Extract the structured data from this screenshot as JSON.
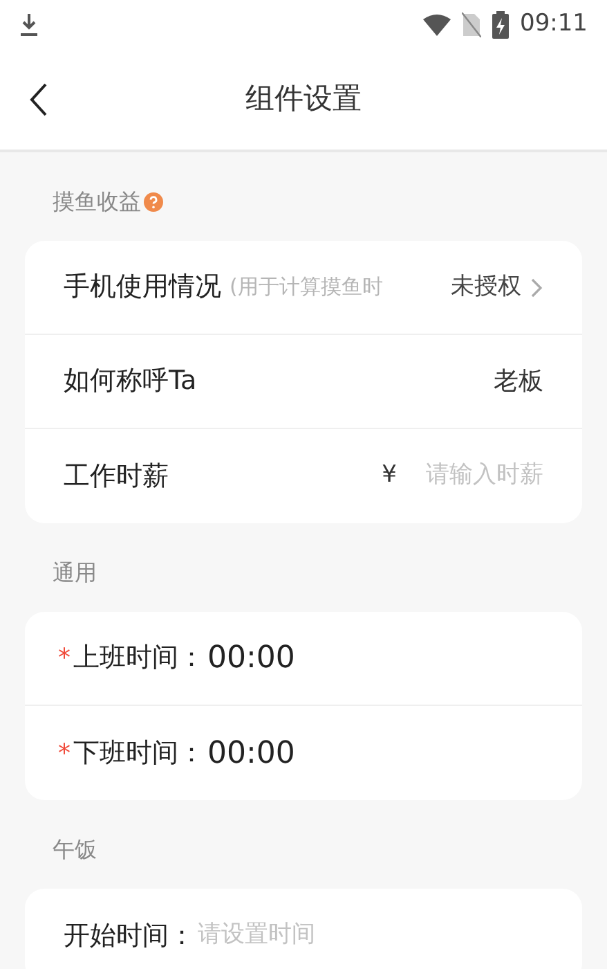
{
  "status_bar": {
    "time": "09:11"
  },
  "header": {
    "title": "组件设置"
  },
  "sections": [
    {
      "title": "摸鱼收益",
      "help": true,
      "rows": [
        {
          "kind": "nav",
          "label": "手机使用情况",
          "hint": "(用于计算摸鱼时",
          "value": "未授权"
        },
        {
          "kind": "value",
          "label": "如何称呼Ta",
          "value": "老板"
        },
        {
          "kind": "input",
          "label": "工作时薪",
          "prefix": "¥",
          "placeholder": "请输入时薪"
        }
      ]
    },
    {
      "title": "通用",
      "help": false,
      "rows": [
        {
          "kind": "time",
          "marker": "*",
          "label": "上班时间：",
          "value": "00:00"
        },
        {
          "kind": "time",
          "marker": "*",
          "label": "下班时间：",
          "value": "00:00"
        }
      ]
    },
    {
      "title": "午饭",
      "help": false,
      "rows": [
        {
          "kind": "time",
          "label": "开始时间：",
          "placeholder": "请设置时间"
        }
      ]
    }
  ]
}
